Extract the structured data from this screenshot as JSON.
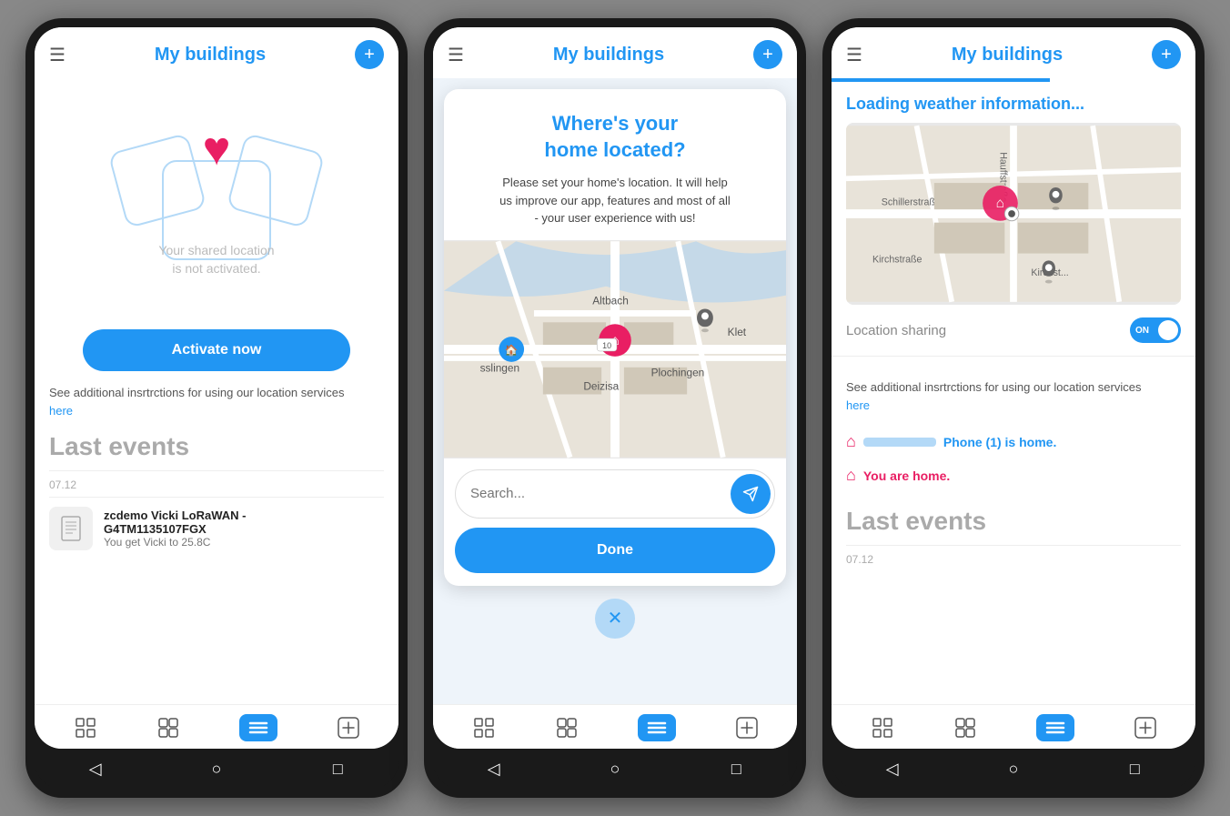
{
  "screens": [
    {
      "id": "screen1",
      "header": {
        "title": "My buildings",
        "menu_icon": "☰",
        "add_icon": "+"
      },
      "location": {
        "disabled_text": "Your shared location\nis not activated.",
        "activate_label": "Activate now"
      },
      "instructions": {
        "text": "See additional insrtrctions for using our location services",
        "link": "here"
      },
      "last_events": {
        "title": "Last events",
        "time": "07.12",
        "item": {
          "title": "zcdemo Vicki LoRaWAN -\nG4TM1135107FGX",
          "desc": "You get Vicki to 25.8C"
        }
      },
      "tabs": [
        {
          "icon": "⊞",
          "active": false
        },
        {
          "icon": "○○\n○○",
          "active": false
        },
        {
          "icon": "≡",
          "active": true
        },
        {
          "icon": "⊕",
          "active": false
        }
      ]
    },
    {
      "id": "screen2",
      "header": {
        "title": "My buildings",
        "menu_icon": "☰",
        "add_icon": "+"
      },
      "modal": {
        "title": "Where's your\nhome located?",
        "subtitle": "Please set your home's location. It will help\nus improve our app, features and most of all\n- your user experience with us!",
        "search_placeholder": "Search...",
        "done_label": "Done",
        "close_icon": "✕",
        "map_labels": [
          "Altbach",
          "Plochingen",
          "Deizisa",
          "sslingen",
          "Klet"
        ]
      },
      "tabs": [
        {
          "icon": "⊞",
          "active": false
        },
        {
          "icon": "○○\n○○",
          "active": false
        },
        {
          "icon": "≡",
          "active": true
        },
        {
          "icon": "⊕",
          "active": false
        }
      ]
    },
    {
      "id": "screen3",
      "header": {
        "title": "My buildings",
        "menu_icon": "☰",
        "add_icon": "+"
      },
      "loading": {
        "text": "Loading weather information..."
      },
      "location_sharing": {
        "label": "Location sharing",
        "toggle_state": "ON"
      },
      "instructions": {
        "text": "See additional insrtrctions for using our location services",
        "link": "here"
      },
      "phone_status": {
        "text": "Phone (1) is home."
      },
      "you_home": {
        "text": "You are home."
      },
      "last_events": {
        "title": "Last events",
        "time": "07.12"
      },
      "tabs": [
        {
          "icon": "⊞",
          "active": false
        },
        {
          "icon": "○○\n○○",
          "active": false
        },
        {
          "icon": "≡",
          "active": true
        },
        {
          "icon": "⊕",
          "active": false
        }
      ]
    }
  ]
}
